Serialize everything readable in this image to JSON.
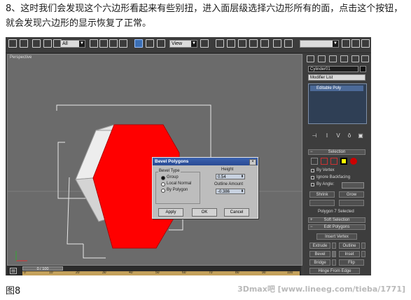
{
  "tutorial": {
    "paragraph": "8、这时我们会发现这个六边形看起来有些别扭，进入面层级选择六边形所有的面，点击这个按钮，就会发现六边形的显示恢复了正常。"
  },
  "figure_label": "图8",
  "watermark": "3Dmax吧 [www.lineeg.com/tieba/1771]",
  "toolbar": {
    "filter_select": "All",
    "reference_select": "View"
  },
  "viewport": {
    "label": "Perspective",
    "object_color": "#ff0000"
  },
  "dialog": {
    "title": "Bevel Polygons",
    "bevel_type_label": "Bevel Type",
    "options": [
      "Group",
      "Local Normal",
      "By Polygon"
    ],
    "selected_option": "Group",
    "height_label": "Height",
    "height_value": "0.54",
    "outline_label": "Outline Amount",
    "outline_value": "-0.386",
    "apply": "Apply",
    "ok": "OK",
    "cancel": "Cancel"
  },
  "command_panel": {
    "object_name": "Cylinder01",
    "modifier_list": "Modifier List",
    "stack_item": "Editable Poly",
    "selection_rollout": "Selection",
    "by_vertex": "By Vertex",
    "ignore_backfacing": "Ignore Backfacing",
    "by_angle": "By Angle:",
    "shrink": "Shrink",
    "grow": "Grow",
    "selected_status": "Polygon 7 Selected",
    "soft_selection": "Soft Selection",
    "edit_polygons": "Edit Polygons",
    "insert_vertex": "Insert Vertex",
    "extrude": "Extrude",
    "outline": "Outline",
    "bevel": "Bevel",
    "inset": "Inset",
    "bridge": "Bridge",
    "flip": "Flip",
    "hinge_from_edge": "Hinge From Edge"
  },
  "timeline": {
    "frame_counter": "0 / 100",
    "ticks": [
      "0",
      "10",
      "20",
      "30",
      "40",
      "50",
      "60",
      "70",
      "80",
      "90",
      "100"
    ]
  },
  "colors": {
    "selection_red": "#ff0000",
    "highlight_blue": "#4c6a98"
  }
}
